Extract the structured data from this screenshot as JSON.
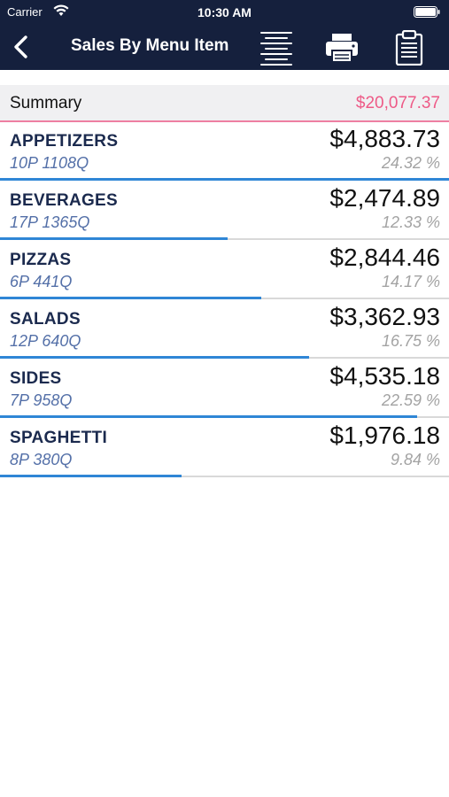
{
  "status_bar": {
    "carrier": "Carrier",
    "time": "10:30 AM"
  },
  "nav": {
    "title": "Sales By Menu Item",
    "icons": [
      "back-chevron-icon",
      "align-center-icon",
      "printer-icon",
      "clipboard-icon"
    ]
  },
  "summary": {
    "label": "Summary",
    "total": "$20,077.37"
  },
  "colors": {
    "nav_background": "#15203d",
    "summary_total": "#ee5a87",
    "progress_fill": "#2f86d6",
    "category_text": "#1b2a4e",
    "sub_text": "#5470a8"
  },
  "items": [
    {
      "name": "APPETIZERS",
      "sub": "10P 1108Q",
      "amount": "$4,883.73",
      "pct": "24.32 %",
      "bar_fraction": 1.0
    },
    {
      "name": "BEVERAGES",
      "sub": "17P 1365Q",
      "amount": "$2,474.89",
      "pct": "12.33 %",
      "bar_fraction": 0.507
    },
    {
      "name": "PIZZAS",
      "sub": "6P 441Q",
      "amount": "$2,844.46",
      "pct": "14.17 %",
      "bar_fraction": 0.582
    },
    {
      "name": "SALADS",
      "sub": "12P 640Q",
      "amount": "$3,362.93",
      "pct": "16.75 %",
      "bar_fraction": 0.689
    },
    {
      "name": "SIDES",
      "sub": "7P 958Q",
      "amount": "$4,535.18",
      "pct": "22.59 %",
      "bar_fraction": 0.929
    },
    {
      "name": "SPAGHETTI",
      "sub": "8P 380Q",
      "amount": "$1,976.18",
      "pct": "9.84 %",
      "bar_fraction": 0.405
    }
  ]
}
